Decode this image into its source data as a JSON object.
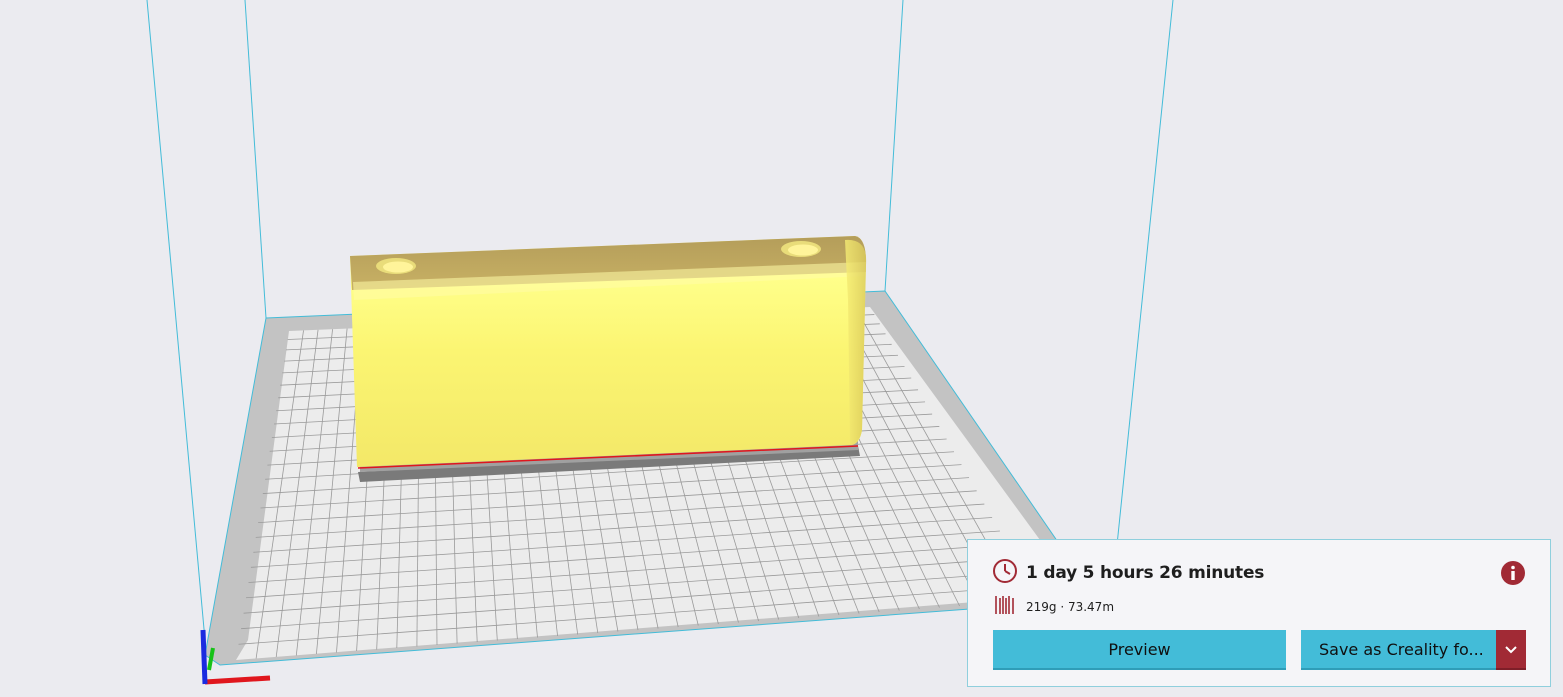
{
  "print_summary": {
    "print_time": "1 day 5 hours 26 minutes",
    "material_usage": "219g · 73.47m",
    "icons": {
      "time": "clock-icon",
      "material": "filament-spool-icon",
      "info": "info-icon",
      "dropdown": "chevron-down-icon"
    }
  },
  "actions": {
    "preview_label": "Preview",
    "save_label": "Save as Creality fo..."
  },
  "colors": {
    "background": "#ebebf0",
    "accent_button": "#43bcd8",
    "accent_brand": "#a12a35",
    "model": "#ffff78",
    "build_volume_lines": "#43bcd8",
    "axis_x": "#e0161d",
    "axis_y": "#1a2be0",
    "axis_z": "#17c217"
  }
}
